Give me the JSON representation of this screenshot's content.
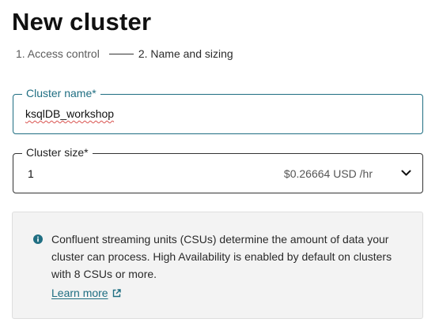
{
  "page": {
    "title": "New cluster"
  },
  "stepper": {
    "steps": [
      {
        "label": "1. Access control",
        "state": "complete"
      },
      {
        "label": "2. Name and sizing",
        "state": "current"
      }
    ]
  },
  "form": {
    "cluster_name": {
      "label": "Cluster name*",
      "value": "ksqlDB_workshop"
    },
    "cluster_size": {
      "label": "Cluster size*",
      "selected": "1",
      "price": "$0.26664 USD /hr",
      "icon": "chevron-down-icon"
    }
  },
  "info": {
    "icon": "info-icon",
    "text": "Confluent streaming units (CSUs) determine the amount of data your cluster can process. High Availability is enabled by default on clusters with 8 CSUs or more.",
    "link_label": "Learn more",
    "link_icon": "external-link-icon"
  },
  "colors": {
    "accent": "#1f6e82",
    "info_background": "#f3f3f3",
    "spellcheck_underline": "#d9534f"
  }
}
